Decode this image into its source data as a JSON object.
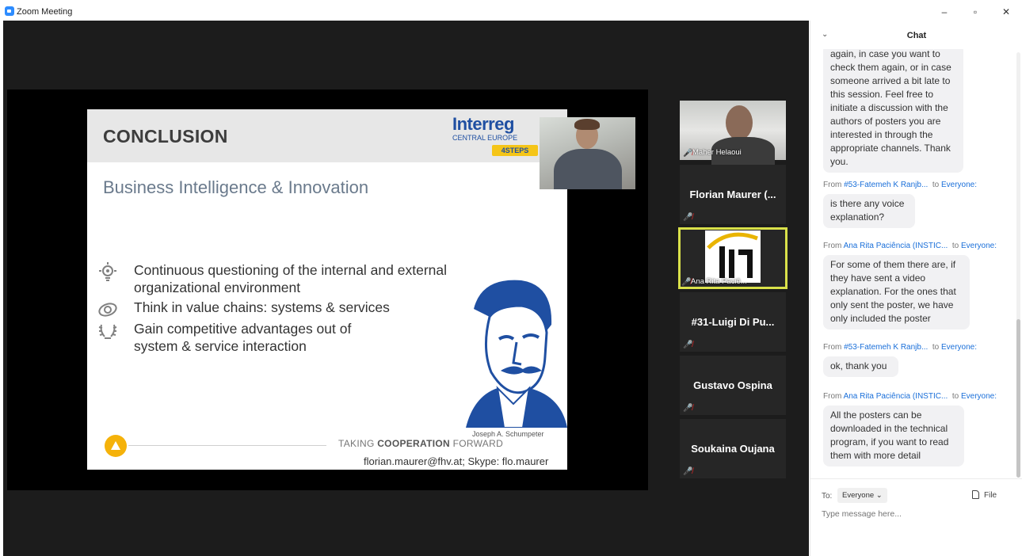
{
  "window": {
    "title": "Zoom Meeting",
    "minimize": "–",
    "restore": "▫",
    "close": "✕"
  },
  "slide": {
    "title": "CONCLUSION",
    "brand": {
      "name": "Interreg",
      "sub": "CENTRAL EUROPE",
      "tag": "4STEPS"
    },
    "subtitle": "Business Intelligence & Innovation",
    "bullets": [
      {
        "icon": "lightbulb-icon",
        "text": "Continuous questioning of the internal and external organizational environment"
      },
      {
        "icon": "rings-icon",
        "text": "Think in value chains: systems & services"
      },
      {
        "icon": "laurel-icon",
        "text": "Gain competitive advantages out of system & service interaction"
      }
    ],
    "caption": "Joseph A. Schumpeter",
    "footer_tag_prefix": "TAKING ",
    "footer_tag_bold": "COOPERATION",
    "footer_tag_suffix": " FORWARD",
    "footer_email": "florian.maurer@fhv.at; Skype: flo.maurer"
  },
  "participants": [
    {
      "name": "Maher Helaoui",
      "type": "video"
    },
    {
      "name": "Florian Maurer (...",
      "type": "name"
    },
    {
      "name": "Ana Rita Paciê...",
      "type": "logo"
    },
    {
      "name": "#31-Luigi Di Pu...",
      "type": "name"
    },
    {
      "name": "Gustavo Ospina",
      "type": "name"
    },
    {
      "name": "Soukaina Oujana",
      "type": "name"
    }
  ],
  "chat": {
    "title": "Chat",
    "first_bubble": "again, in case you want to check them again, or in case someone arrived a bit late to this session. Feel free to initiate a discussion with the authors of posters you are interested in through the appropriate channels. Thank you.",
    "messages": [
      {
        "from_prefix": "From ",
        "from": "#53-Fatemeh K Ranjb...",
        "to_prefix": "to ",
        "to": "Everyone:",
        "text": "is there any voice explanation?"
      },
      {
        "from_prefix": "From ",
        "from": "Ana Rita Paciência (INSTIC...",
        "to_prefix": "to ",
        "to": "Everyone:",
        "text": "For some of them there are, if they have sent a video explanation. For the ones that only sent the poster, we have only included the poster"
      },
      {
        "from_prefix": "From ",
        "from": "#53-Fatemeh K Ranjb...",
        "to_prefix": "to ",
        "to": "Everyone:",
        "text": "ok, thank you"
      },
      {
        "from_prefix": "From ",
        "from": "Ana Rita Paciência (INSTIC...",
        "to_prefix": "to ",
        "to": "Everyone:",
        "text": "All the posters can be downloaded in the technical program, if you want to read them with more detail"
      }
    ],
    "to_label": "To:",
    "recipient": "Everyone",
    "file_label": "File",
    "input_placeholder": "Type message here..."
  }
}
